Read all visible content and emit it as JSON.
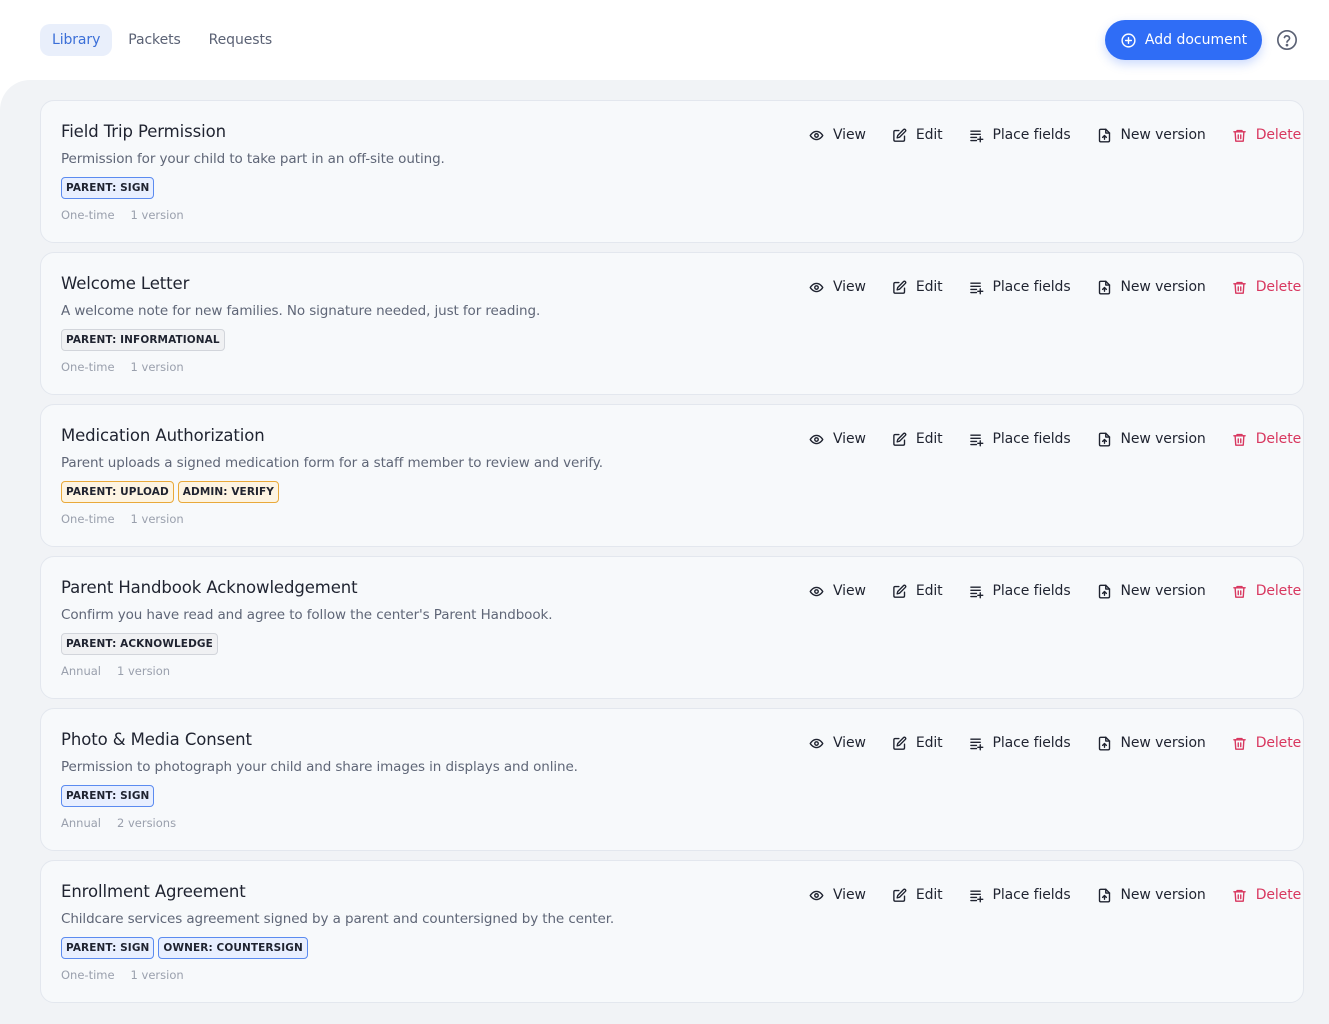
{
  "nav": {
    "tabs": [
      {
        "label": "Library",
        "active": true
      },
      {
        "label": "Packets",
        "active": false
      },
      {
        "label": "Requests",
        "active": false
      }
    ]
  },
  "header": {
    "add_button_label": "Add document",
    "add_button_icon": "plus-circle-icon",
    "help_icon": "help-circle-icon"
  },
  "colors": {
    "accent": "#2f6df6",
    "danger": "#d8375f",
    "active_tab_bg": "#e9effb"
  },
  "actions": {
    "view": "View",
    "edit": "Edit",
    "place_fields": "Place fields",
    "new_version": "New version",
    "delete": "Delete"
  },
  "documents": [
    {
      "title": "Field Trip Permission",
      "description": "Permission for your child to take part in an off-site outing.",
      "badges": [
        {
          "label": "PARENT: SIGN",
          "style": "blue"
        }
      ],
      "frequency": "One-time",
      "versions": "1 version"
    },
    {
      "title": "Welcome Letter",
      "description": "A welcome note for new families. No signature needed, just for reading.",
      "badges": [
        {
          "label": "PARENT: INFORMATIONAL",
          "style": "gray"
        }
      ],
      "frequency": "One-time",
      "versions": "1 version"
    },
    {
      "title": "Medication Authorization",
      "description": "Parent uploads a signed medication form for a staff member to review and verify.",
      "badges": [
        {
          "label": "PARENT: UPLOAD",
          "style": "amber"
        },
        {
          "label": "ADMIN: VERIFY",
          "style": "amber"
        }
      ],
      "frequency": "One-time",
      "versions": "1 version"
    },
    {
      "title": "Parent Handbook Acknowledgement",
      "description": "Confirm you have read and agree to follow the center's Parent Handbook.",
      "badges": [
        {
          "label": "PARENT: ACKNOWLEDGE",
          "style": "gray"
        }
      ],
      "frequency": "Annual",
      "versions": "1 version"
    },
    {
      "title": "Photo & Media Consent",
      "description": "Permission to photograph your child and share images in displays and online.",
      "badges": [
        {
          "label": "PARENT: SIGN",
          "style": "blue"
        }
      ],
      "frequency": "Annual",
      "versions": "2 versions"
    },
    {
      "title": "Enrollment Agreement",
      "description": "Childcare services agreement signed by a parent and countersigned by the center.",
      "badges": [
        {
          "label": "PARENT: SIGN",
          "style": "blue"
        },
        {
          "label": "OWNER: COUNTERSIGN",
          "style": "blue"
        }
      ],
      "frequency": "One-time",
      "versions": "1 version"
    }
  ]
}
